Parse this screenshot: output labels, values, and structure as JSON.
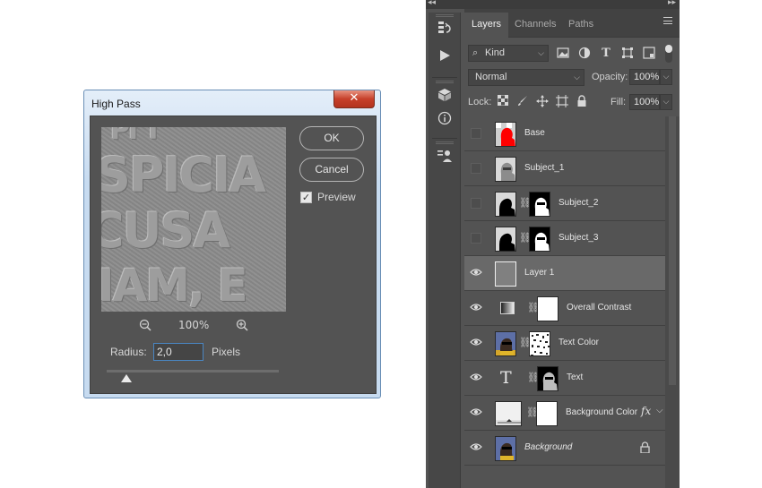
{
  "dialog": {
    "title": "High Pass",
    "close_symbol": "✕",
    "ok_label": "OK",
    "cancel_label": "Cancel",
    "preview_label": "Preview",
    "preview_checked": true,
    "zoom_level": "100%",
    "zoom_out_icon": "zoom-out-icon",
    "zoom_in_icon": "zoom-in-icon",
    "radius_label": "Radius:",
    "radius_value": "2,0",
    "radius_unit": "Pixels"
  },
  "preview_text_lines": [
    "PI T",
    "SPICIA",
    "CUSA",
    "IAM, E"
  ],
  "toolbar": {
    "items": [
      "history-icon",
      "play-icon",
      "3d-icon",
      "info-icon",
      "properties-icon"
    ]
  },
  "panel": {
    "tabs": [
      {
        "label": "Layers",
        "active": true
      },
      {
        "label": "Channels",
        "active": false
      },
      {
        "label": "Paths",
        "active": false
      }
    ],
    "filter_kind": "Kind",
    "blend_mode": "Normal",
    "opacity_label": "Opacity:",
    "opacity_value": "100%",
    "lock_label": "Lock:",
    "fill_label": "Fill:",
    "fill_value": "100%"
  },
  "layers": [
    {
      "name": "Base",
      "visible": false,
      "thumb": "red-silhouette",
      "mask": false,
      "italic": false
    },
    {
      "name": "Subject_1",
      "visible": false,
      "thumb": "gray-figure",
      "mask": false,
      "italic": false
    },
    {
      "name": "Subject_2",
      "visible": false,
      "thumb": "black-silhouette",
      "mask": true,
      "italic": false
    },
    {
      "name": "Subject_3",
      "visible": false,
      "thumb": "black-silhouette",
      "mask": true,
      "italic": false
    },
    {
      "name": "Layer 1",
      "visible": true,
      "thumb": "gray-fill",
      "mask": false,
      "italic": false,
      "selected": true
    },
    {
      "name": "Overall Contrast",
      "visible": true,
      "thumb": "gradient-adjustment",
      "mask": true,
      "italic": false
    },
    {
      "name": "Text Color",
      "visible": true,
      "thumb": "photo-portrait",
      "mask": true,
      "italic": false
    },
    {
      "name": "Text",
      "visible": true,
      "thumb": "type-layer",
      "mask": true,
      "italic": false
    },
    {
      "name": "Background Color",
      "visible": true,
      "thumb": "solid-fill",
      "mask": true,
      "italic": false,
      "fx": "fx"
    },
    {
      "name": "Background",
      "visible": true,
      "thumb": "photo-portrait",
      "mask": false,
      "italic": true,
      "locked": true
    }
  ],
  "colors": {
    "panel_bg": "#535353",
    "selected_layer": "#696969",
    "base_thumb_red": "#ff0000",
    "accent_blue": "#4a86c2"
  }
}
